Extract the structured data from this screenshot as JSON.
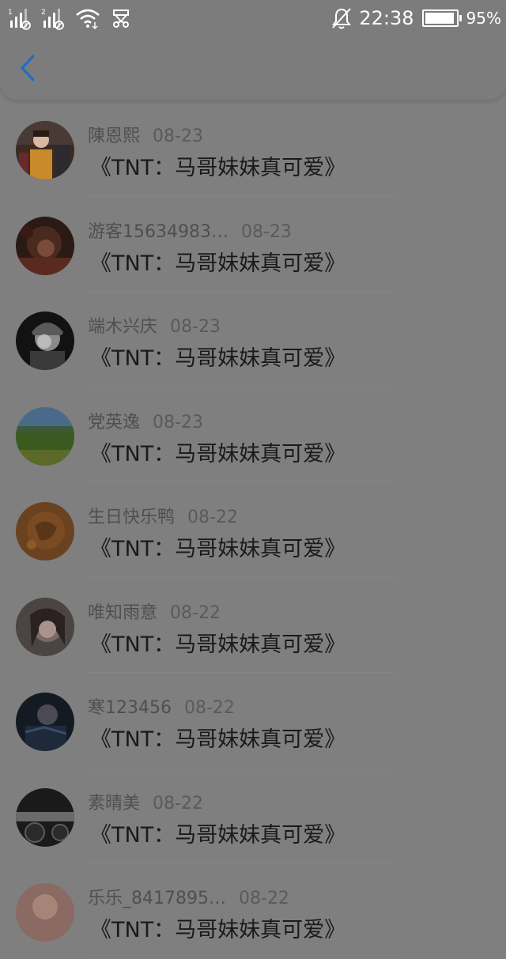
{
  "status_bar": {
    "time": "22:38",
    "battery_percent": "95%",
    "battery_level": 0.95,
    "icons": [
      "sim1-signal-icon",
      "sim2-signal-icon",
      "wifi-icon",
      "usb-icon",
      "alarm-off-icon",
      "battery-icon"
    ],
    "sim1_label": "1",
    "sim2_label": "2"
  },
  "header": {
    "back_icon": "chevron-left-icon",
    "accent_color": "#1e6fc0"
  },
  "comments": [
    {
      "user": "陳恩熙",
      "date": "08-23",
      "title": "《TNT：马哥妹妹真可爱》"
    },
    {
      "user": "游客15634983…",
      "date": "08-23",
      "title": "《TNT：马哥妹妹真可爱》"
    },
    {
      "user": "端木兴庆",
      "date": "08-23",
      "title": "《TNT：马哥妹妹真可爱》"
    },
    {
      "user": "党英逸",
      "date": "08-23",
      "title": "《TNT：马哥妹妹真可爱》"
    },
    {
      "user": "生日快乐鸭",
      "date": "08-22",
      "title": "《TNT：马哥妹妹真可爱》"
    },
    {
      "user": "唯知雨意",
      "date": "08-22",
      "title": "《TNT：马哥妹妹真可爱》"
    },
    {
      "user": "寒123456",
      "date": "08-22",
      "title": "《TNT：马哥妹妹真可爱》"
    },
    {
      "user": "素晴美",
      "date": "08-22",
      "title": "《TNT：马哥妹妹真可爱》"
    },
    {
      "user": "乐乐_8417895…",
      "date": "08-22",
      "title": "《TNT：马哥妹妹真可爱》"
    }
  ]
}
